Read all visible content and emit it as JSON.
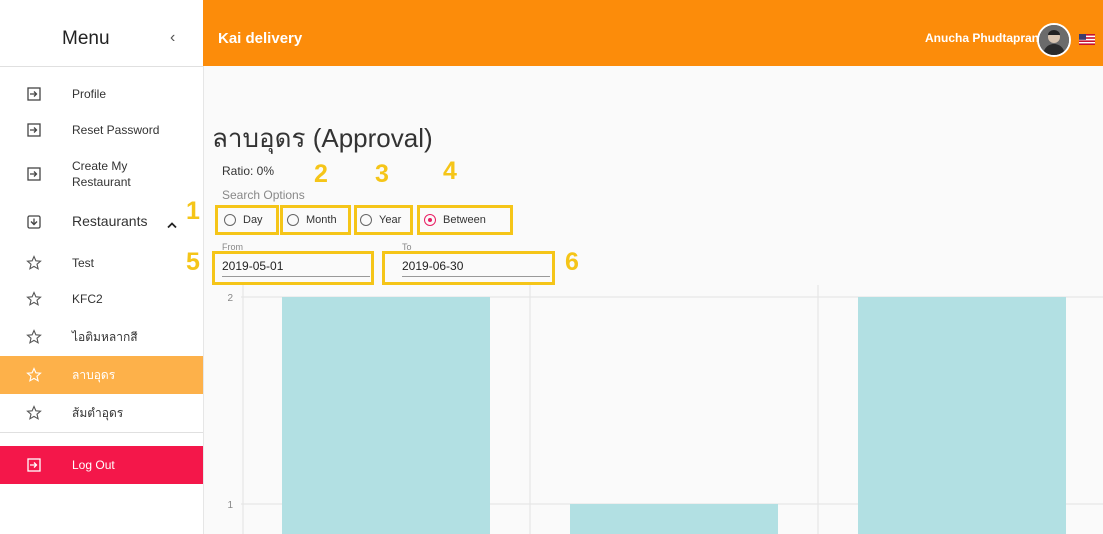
{
  "sidebar": {
    "title": "Menu",
    "close_icon": "chevron-left-icon",
    "items": [
      {
        "label": "Profile",
        "icon": "login-icon"
      },
      {
        "label": "Reset Password",
        "icon": "login-icon"
      },
      {
        "label": "Create My Restaurant",
        "icon": "login-icon"
      },
      {
        "label": "Restaurants",
        "icon": "store-icon",
        "expand_icon": "chevron-up-icon"
      },
      {
        "label": "Test",
        "icon": "star-outline-icon"
      },
      {
        "label": "KFC2",
        "icon": "star-outline-icon"
      },
      {
        "label": "ไอติมหลากสี",
        "icon": "star-outline-icon"
      },
      {
        "label": "ลาบอุดร",
        "icon": "star-outline-icon",
        "active": true
      },
      {
        "label": "ส้มตำอุดร",
        "icon": "star-outline-icon"
      }
    ],
    "logout": {
      "label": "Log Out",
      "icon": "login-icon"
    }
  },
  "header": {
    "app_title": "Kai delivery",
    "user_name": "Anucha Phudtapranee",
    "avatar": "avatar",
    "flag": "us-flag-icon"
  },
  "main": {
    "title": "ลาบอุดร (Approval)",
    "ratio": "Ratio: 0%",
    "search_options_label": "Search Options",
    "options": [
      {
        "label": "Day",
        "checked": false
      },
      {
        "label": "Month",
        "checked": false
      },
      {
        "label": "Year",
        "checked": false
      },
      {
        "label": "Between",
        "checked": true
      }
    ],
    "from": {
      "label": "From",
      "value": "2019-05-01"
    },
    "to": {
      "label": "To",
      "value": "2019-06-30"
    },
    "annotations": [
      "1",
      "2",
      "3",
      "4",
      "5",
      "6"
    ]
  },
  "colors": {
    "header_bg": "#fc8c0a",
    "active_item_bg": "#fdb14a",
    "logout_bg": "#f4174a",
    "radio_checked": "#e91e63",
    "annotation": "#f5c518",
    "bar": "#b2e0e3"
  },
  "chart_data": {
    "type": "bar",
    "categories": [
      "",
      "",
      ""
    ],
    "values": [
      2,
      1,
      2
    ],
    "yticks": [
      "2",
      "1"
    ],
    "ylim": [
      0,
      2
    ],
    "color": "#b2e0e3"
  }
}
